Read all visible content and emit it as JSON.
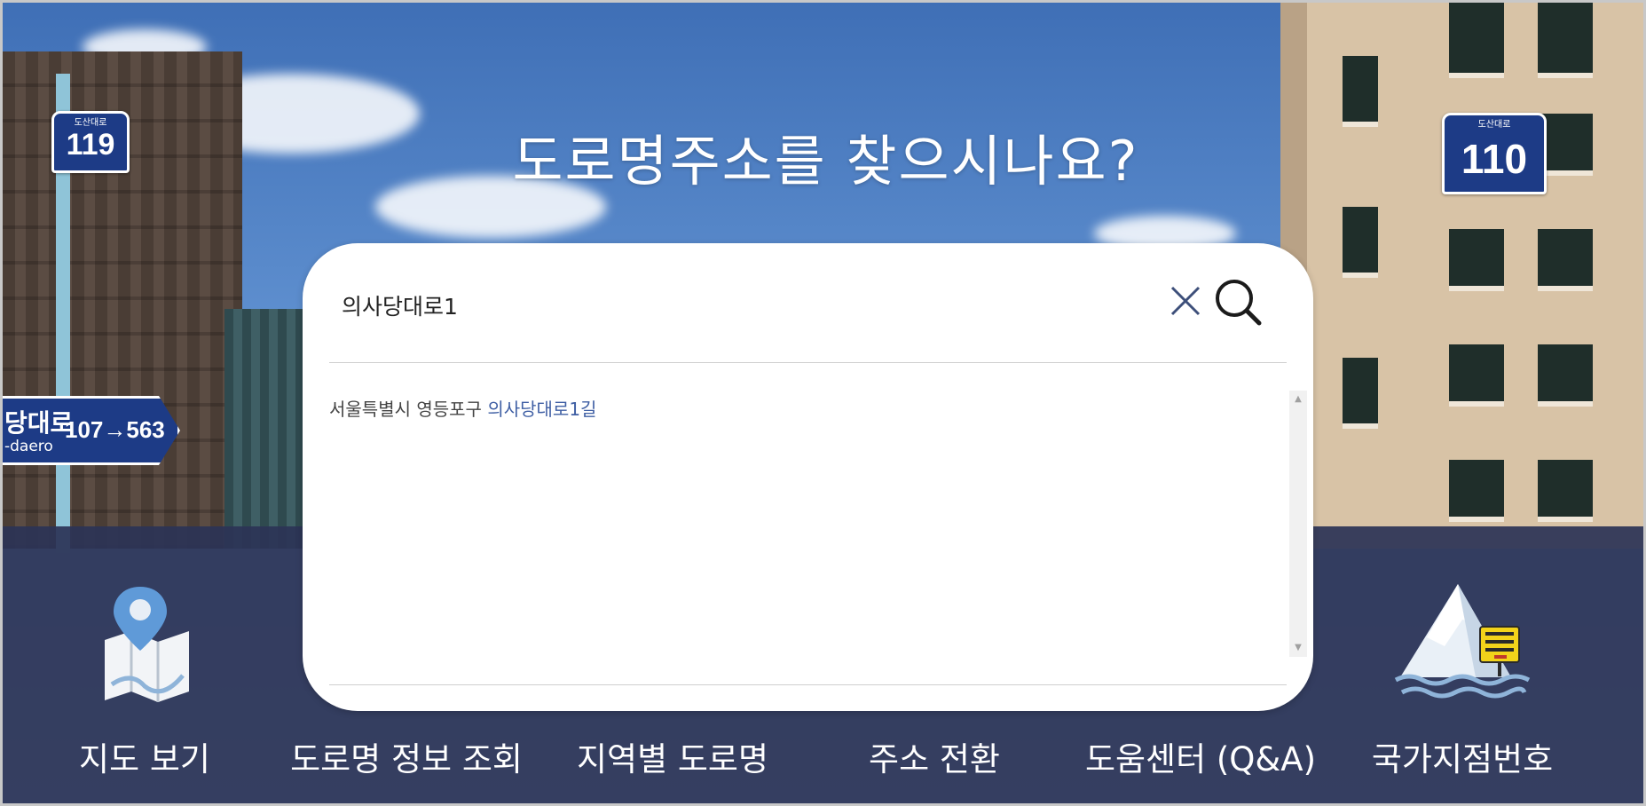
{
  "hero": {
    "headline": "도로명주소를 찾으시나요?"
  },
  "signs": {
    "left_building_number": "119",
    "left_building_road_small": "도산대로",
    "right_building_number": "110",
    "right_building_road_small": "도산대로",
    "road_sign_korean": "당대로",
    "road_sign_english": "-daero",
    "road_sign_range": "107→563"
  },
  "search": {
    "value": "의사당대로1",
    "clear_icon": "close-icon",
    "search_icon": "search-icon"
  },
  "results": [
    {
      "prefix": "서울특별시 영등포구 ",
      "match": "의사당대로1길"
    }
  ],
  "nav": [
    {
      "label": "지도 보기",
      "icon": "map-pin-icon"
    },
    {
      "label": "도로명 정보 조회",
      "icon": ""
    },
    {
      "label": "지역별 도로명",
      "icon": ""
    },
    {
      "label": "주소 전환",
      "icon": ""
    },
    {
      "label": "도움센터 (Q&A)",
      "icon": ""
    },
    {
      "label": "국가지점번호",
      "icon": "mountain-sign-icon"
    }
  ],
  "colors": {
    "nav_band": "#2c3456",
    "sign_blue": "#1d3b86",
    "highlight": "#3f5fa4"
  }
}
